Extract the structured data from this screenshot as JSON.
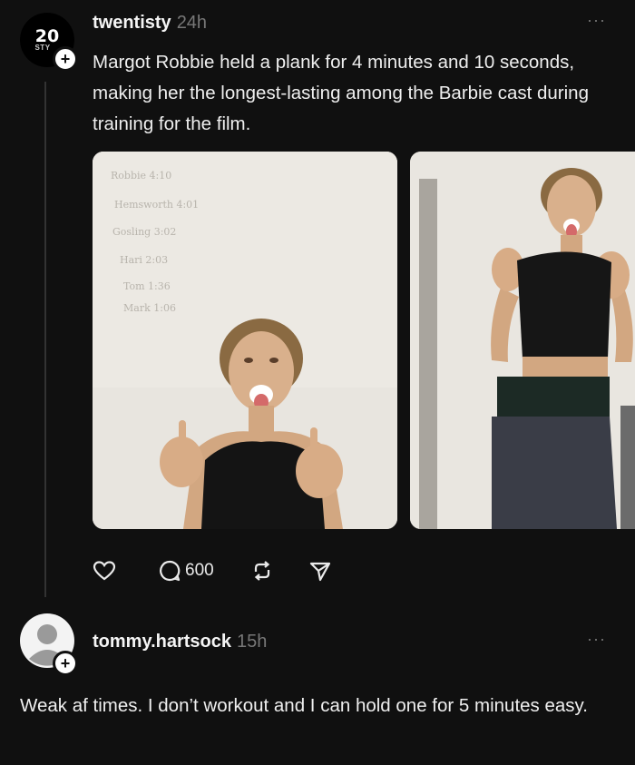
{
  "post": {
    "avatar_big": "20",
    "avatar_small": "STY",
    "username": "twentisty",
    "time": "24h",
    "more": "···",
    "text": "Margot Robbie held a plank for 4 minutes and 10 seconds, making her the longest-lasting among the Barbie cast during training for the film.",
    "board": [
      "Robbie 4:10",
      "Hemsworth 4:01",
      "Gosling 3:02",
      "Hari 2:03",
      "Tom 1:36",
      "Mark 1:06"
    ],
    "actions": {
      "like_icon": "heart-icon",
      "comment_icon": "comment-icon",
      "comment_count": "600",
      "repost_icon": "repost-icon",
      "share_icon": "send-icon"
    }
  },
  "reply": {
    "username": "tommy.hartsock",
    "time": "15h",
    "more": "···",
    "text": "Weak af times. I don’t workout and I can hold one for 5 minutes easy."
  },
  "colors": {
    "background": "#101010",
    "text": "#f2f2f2",
    "muted": "#777777"
  }
}
